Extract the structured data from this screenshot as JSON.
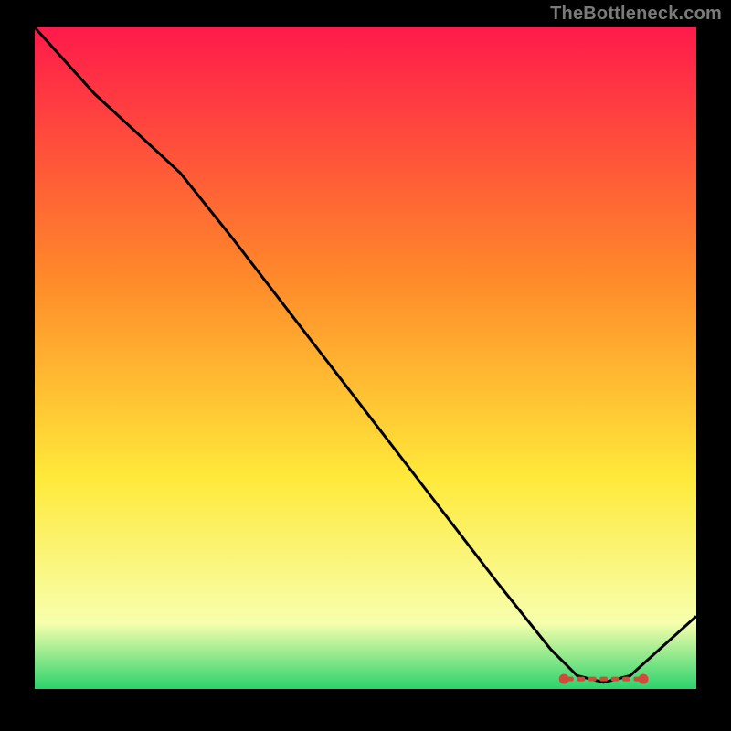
{
  "attribution": "TheBottleneck.com",
  "chart_data": {
    "type": "line",
    "title": "",
    "xlabel": "",
    "ylabel": "",
    "xlim": [
      0,
      100
    ],
    "ylim": [
      0,
      100
    ],
    "gradient": {
      "top": "#ff1a4b",
      "upper_mid": "#ff8a2a",
      "mid": "#ffe93a",
      "lower": "#f7ffad",
      "bottom": "#2bd36c"
    },
    "x": [
      0,
      9,
      22,
      30,
      40,
      50,
      60,
      70,
      78,
      82,
      86,
      90,
      100
    ],
    "values": [
      100,
      90,
      78,
      68,
      55,
      42,
      29,
      16,
      6,
      2,
      1,
      2,
      11
    ],
    "marker_band": {
      "y": 1.5,
      "x_start": 80,
      "x_end": 92,
      "color": "#d24a3a"
    }
  }
}
